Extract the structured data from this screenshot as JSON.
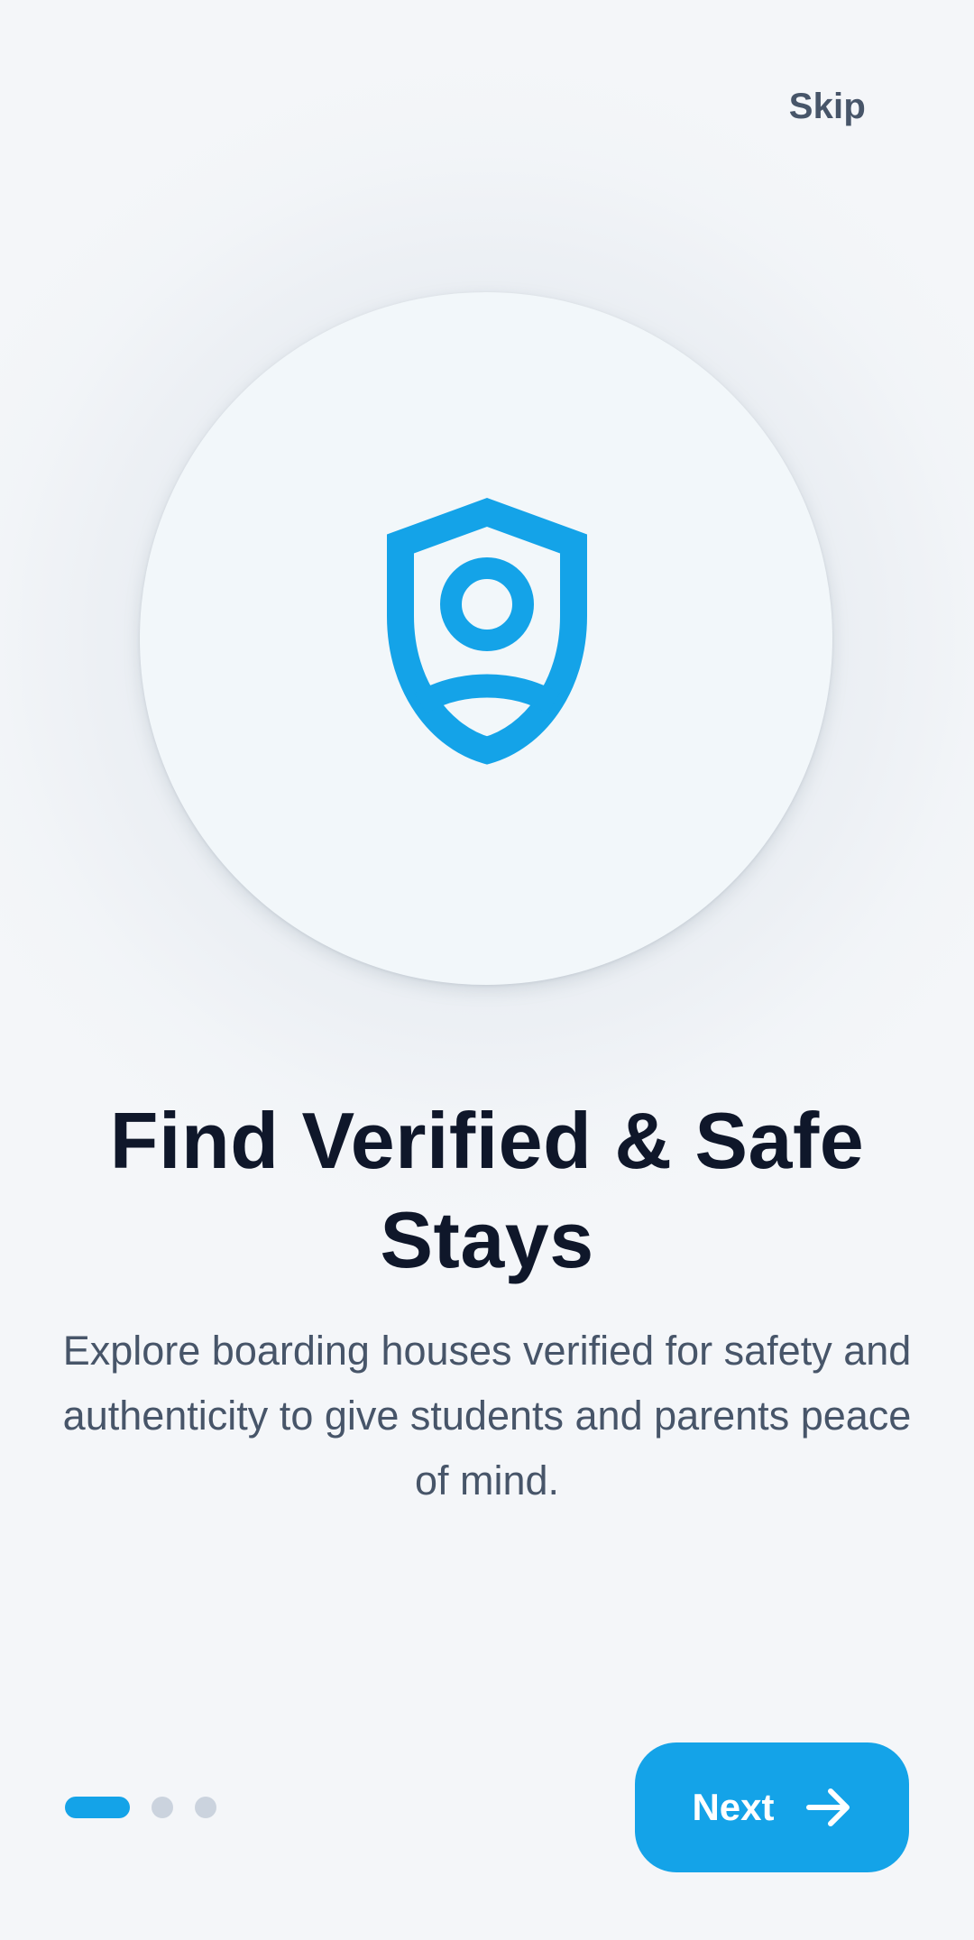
{
  "header": {
    "skip_label": "Skip"
  },
  "hero": {
    "icon": "shield-user-icon"
  },
  "content": {
    "title": "Find Verified & Safe Stays",
    "description": "Explore boarding houses verified for safety and authenticity to give students and parents peace of mind."
  },
  "pagination": {
    "total_pages": 3,
    "current_page": 1
  },
  "footer": {
    "next_label": "Next",
    "next_icon": "arrow-right-icon"
  },
  "colors": {
    "accent": "#14a3e8",
    "title": "#0f172a",
    "body_text": "#475569",
    "inactive_dot": "#cbd3de",
    "background": "#f4f6f9"
  }
}
